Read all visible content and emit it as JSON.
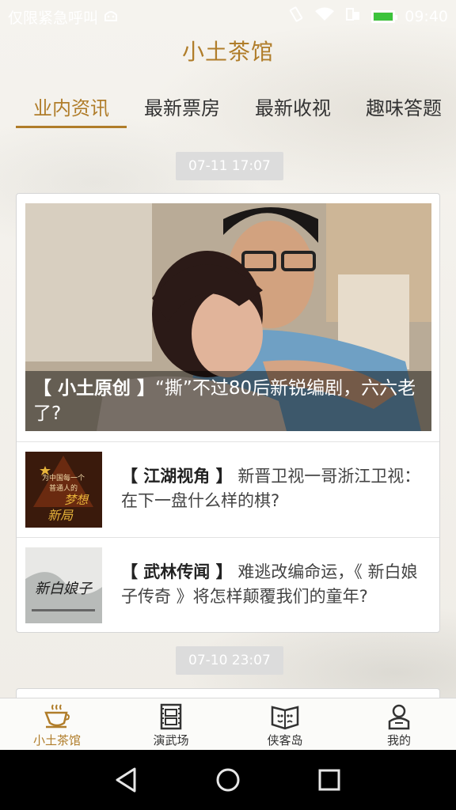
{
  "status_bar": {
    "carrier": "仅限紧急呼叫",
    "time": "09:40"
  },
  "header": {
    "title": "小土茶馆"
  },
  "tabs": [
    {
      "label": "业内资讯",
      "active": true
    },
    {
      "label": "最新票房",
      "active": false
    },
    {
      "label": "最新收视",
      "active": false
    },
    {
      "label": "趣味答题",
      "active": false
    }
  ],
  "feed": [
    {
      "date": "07-11 17:07",
      "hero": {
        "tag": "【 小土原创 】",
        "title": "“撕”不过80后新锐编剧，六六老了?"
      },
      "items": [
        {
          "tag": "【 江湖视角 】",
          "title": "新晋卫视一哥浙江卫视：在下一盘什么样的棋?",
          "thumb_text": [
            "为中国每一个",
            "普通人的",
            "梦想",
            "新局"
          ]
        },
        {
          "tag": "【 武林传闻 】",
          "title": "难逃改编命运，《 新白娘子传奇 》将怎样颠覆我们的童年?",
          "thumb_text": [
            "新白娘子"
          ]
        }
      ]
    },
    {
      "date": "07-10 23:07"
    }
  ],
  "bottom_nav": [
    {
      "label": "小土茶馆",
      "icon": "tea-cup-icon",
      "active": true
    },
    {
      "label": "演武场",
      "icon": "film-icon",
      "active": false
    },
    {
      "label": "侠客岛",
      "icon": "theater-masks-icon",
      "active": false
    },
    {
      "label": "我的",
      "icon": "user-icon",
      "active": false
    }
  ],
  "colors": {
    "accent": "#b07d2a",
    "text": "#333333",
    "pill_bg": "#dcdcdc"
  }
}
